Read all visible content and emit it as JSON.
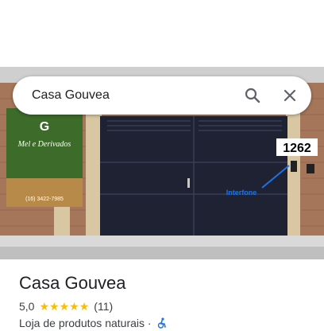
{
  "search": {
    "query": "Casa Gouvea"
  },
  "photo": {
    "banner_brand": "G",
    "banner_title": "Mel e Derivados",
    "banner_phone": "(16) 3422-7985",
    "house_number": "1262",
    "intercom_label": "Interfone"
  },
  "place": {
    "name": "Casa Gouvea",
    "rating": "5,0",
    "stars": 5,
    "review_count": "(11)",
    "category": "Loja de produtos naturais ·"
  },
  "colors": {
    "star": "#fbbc04",
    "accent": "#1a73e8"
  },
  "icons": {
    "search": "search-icon",
    "close": "close-icon",
    "accessibility": "wheelchair-icon"
  }
}
